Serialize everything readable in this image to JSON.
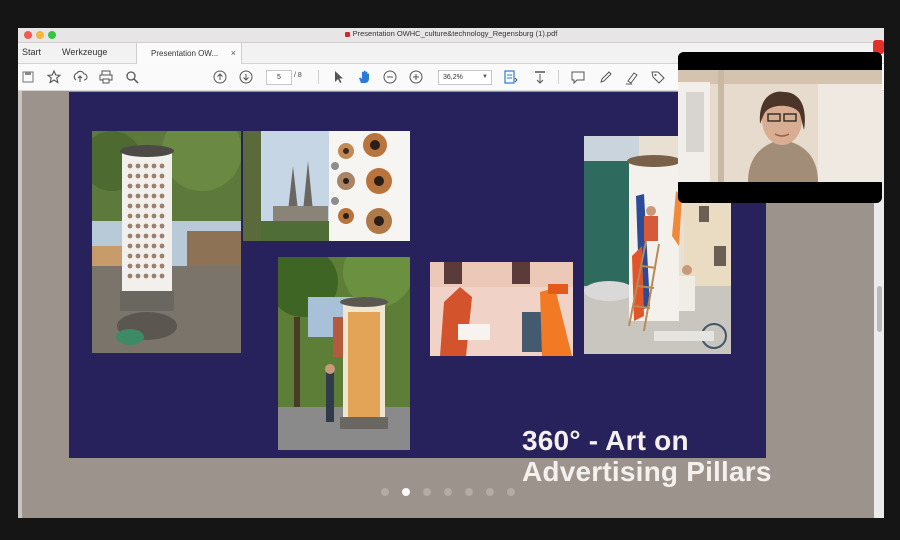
{
  "window": {
    "title": "Presentation OWHC_culture&technology_Regensburg (1).pdf",
    "traffic_colors": [
      "#f25a55",
      "#f6b53c",
      "#34c545"
    ]
  },
  "tabs": {
    "start": "Start",
    "tools": "Werkzeuge",
    "document": "Presentation OW...",
    "close": "×"
  },
  "toolbar": {
    "page_current": "5",
    "page_total": "/ 8",
    "zoom": "36,2%",
    "icons": [
      "save-icon",
      "star-icon",
      "upload-icon",
      "print-icon",
      "search-icon",
      "page-up-icon",
      "page-down-icon",
      "select-arrow-icon",
      "hand-icon",
      "zoom-out-icon",
      "zoom-in-icon",
      "fit-page-icon",
      "scroll-mode-icon",
      "comment-icon",
      "pen-icon",
      "highlight-icon",
      "tag-icon"
    ]
  },
  "slide": {
    "background": "#28225c",
    "title_line1": "360° - Art on",
    "title_line2": "Advertising Pillars",
    "photos": [
      "dotted-pillar-photo",
      "cathedral-and-pattern-photo",
      "orange-pillar-photo",
      "painting-wall-photo",
      "ladder-painting-photo"
    ]
  },
  "pager": {
    "count": 7,
    "active_index": 1
  },
  "video": {
    "participant": "presenter-video"
  }
}
